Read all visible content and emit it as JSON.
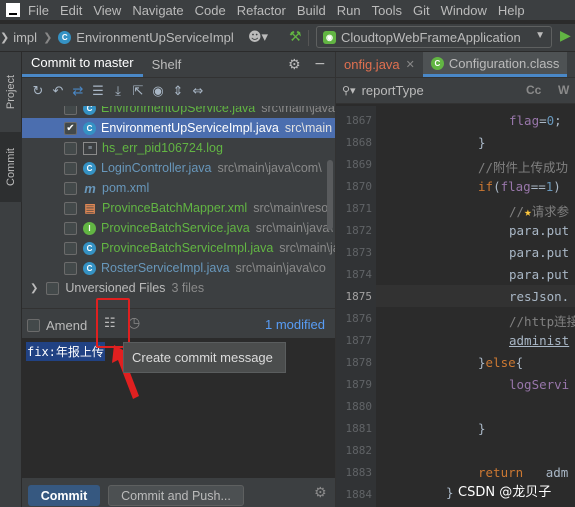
{
  "menubar": {
    "items": [
      "File",
      "Edit",
      "View",
      "Navigate",
      "Code",
      "Refactor",
      "Build",
      "Run",
      "Tools",
      "Git",
      "Window",
      "Help"
    ]
  },
  "toolbar": {
    "project": "impl",
    "file": "EnvironmentUpServiceImpl",
    "run_config": "CloudtopWebFrameApplication"
  },
  "side_tabs": {
    "project": "Project",
    "commit": "Commit"
  },
  "commit_panel": {
    "tabs": [
      "Commit to master",
      "Shelf"
    ],
    "files": [
      {
        "name": "EnvironmentUpService.java",
        "path": "src\\main\\java",
        "checked": false,
        "color": "green",
        "icon": "class-icon"
      },
      {
        "name": "EnvironmentUpServiceImpl.java",
        "path": "src\\main",
        "checked": true,
        "color": "blue",
        "icon": "class-icon",
        "selected": true
      },
      {
        "name": "hs_err_pid106724.log",
        "path": "",
        "checked": false,
        "color": "green",
        "icon": "log-icon"
      },
      {
        "name": "LoginController.java",
        "path": "src\\main\\java\\com\\",
        "checked": false,
        "color": "blue",
        "icon": "class-icon"
      },
      {
        "name": "pom.xml",
        "path": "",
        "checked": false,
        "color": "blue",
        "icon": "maven-icon"
      },
      {
        "name": "ProvinceBatchMapper.xml",
        "path": "src\\main\\reso",
        "checked": false,
        "color": "green",
        "icon": "xml-icon"
      },
      {
        "name": "ProvinceBatchService.java",
        "path": "src\\main\\java\\",
        "checked": false,
        "color": "green",
        "icon": "interface-icon"
      },
      {
        "name": "ProvinceBatchServiceImpl.java",
        "path": "src\\main\\java",
        "checked": false,
        "color": "green",
        "icon": "class-icon"
      },
      {
        "name": "RosterServiceImpl.java",
        "path": "src\\main\\java\\co",
        "checked": false,
        "color": "blue",
        "icon": "class-icon"
      }
    ],
    "unversioned_label": "Unversioned Files",
    "unversioned_count": "3 files",
    "amend_label": "Amend",
    "modified_label": "1 modified",
    "commit_message": "fix:年报上传",
    "tooltip": "Create commit message",
    "commit_button": "Commit",
    "commit_push_button": "Commit and Push..."
  },
  "editor": {
    "tabs": [
      "onfig.java",
      "Configuration.class"
    ],
    "search_query": "reportType",
    "search_btn1": "Cc",
    "search_btn2": "W",
    "line_numbers": [
      "1867",
      "1868",
      "1869",
      "1870",
      "1871",
      "1872",
      "1873",
      "1874",
      "1875",
      "1876",
      "1877",
      "1878",
      "1879",
      "1880",
      "1881",
      "1882",
      "1883",
      "1884"
    ],
    "current_line": "1875"
  },
  "watermark": "CSDN @龙贝子",
  "colors": {
    "accent": "#4a88c7",
    "selection": "#4b6eaf",
    "red_highlight": "#e02020"
  }
}
